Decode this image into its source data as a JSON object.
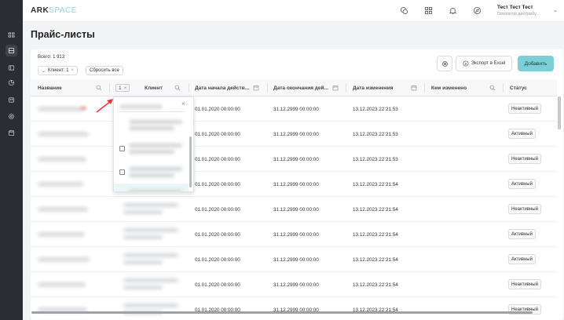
{
  "app": {
    "logo_main": "ARK",
    "logo_accent": "SPACE"
  },
  "user": {
    "name": "Тест Тест Тест",
    "role": "Оператор дистрибу..."
  },
  "page": {
    "title": "Прайс-листы"
  },
  "toolbar": {
    "total_label": "Всего: 1 913",
    "filter_chip_label": "Клиент: 1",
    "reset_label": "Сбросить все",
    "export_label": "Экспорт в Excel",
    "add_label": "Добавить"
  },
  "table": {
    "columns": {
      "name": "Название",
      "client_count": "1",
      "client": "Клиент",
      "start_date": "Дата начала действ...",
      "end_date": "Дата окончания дей...",
      "changed_at": "Дата изменения",
      "changed_by": "Кем изменено",
      "status": "Статус"
    },
    "rows": [
      {
        "start": "01.01.2020 00:00:00",
        "end": "31.12.2999 00:00:00",
        "changed": "13.12.2023 22:21:53",
        "status": "Неактивный"
      },
      {
        "start": "01.01.2020 00:00:00",
        "end": "31.12.2999 00:00:00",
        "changed": "13.12.2023 22:21:53",
        "status": "Активный"
      },
      {
        "start": "01.01.2020 00:00:00",
        "end": "31.12.2999 00:00:00",
        "changed": "13.12.2023 22:21:53",
        "status": "Неактивный"
      },
      {
        "start": "01.01.2020 00:00:00",
        "end": "31.12.2999 00:00:00",
        "changed": "13.12.2023 22:21:54",
        "status": "Активный"
      },
      {
        "start": "01.01.2020 00:00:00",
        "end": "31.12.2999 00:00:00",
        "changed": "13.12.2023 22:21:54",
        "status": "Неактивный"
      },
      {
        "start": "01.01.2020 00:00:00",
        "end": "31.12.2999 00:00:00",
        "changed": "13.12.2023 22:21:54",
        "status": "Активный"
      },
      {
        "start": "01.01.2020 00:00:00",
        "end": "31.12.2999 00:00:00",
        "changed": "13.12.2023 22:21:54",
        "status": "Активный"
      },
      {
        "start": "01.01.2020 00:00:00",
        "end": "31.12.2999 00:00:00",
        "changed": "13.12.2023 22:21:54",
        "status": "Неактивный"
      },
      {
        "start": "01.01.2020 00:00:00",
        "end": "31.12.2999 00:00:00",
        "changed": "13.12.2023 22:21:54",
        "status": "Неактивный"
      }
    ]
  },
  "dropdown": {
    "items": [
      {
        "checked": false
      },
      {
        "checked": false
      },
      {
        "checked": true
      }
    ]
  },
  "colors": {
    "accent": "#7ccfd6",
    "sidebar": "#2b2d33",
    "annotation_arrow": "#e53935"
  }
}
